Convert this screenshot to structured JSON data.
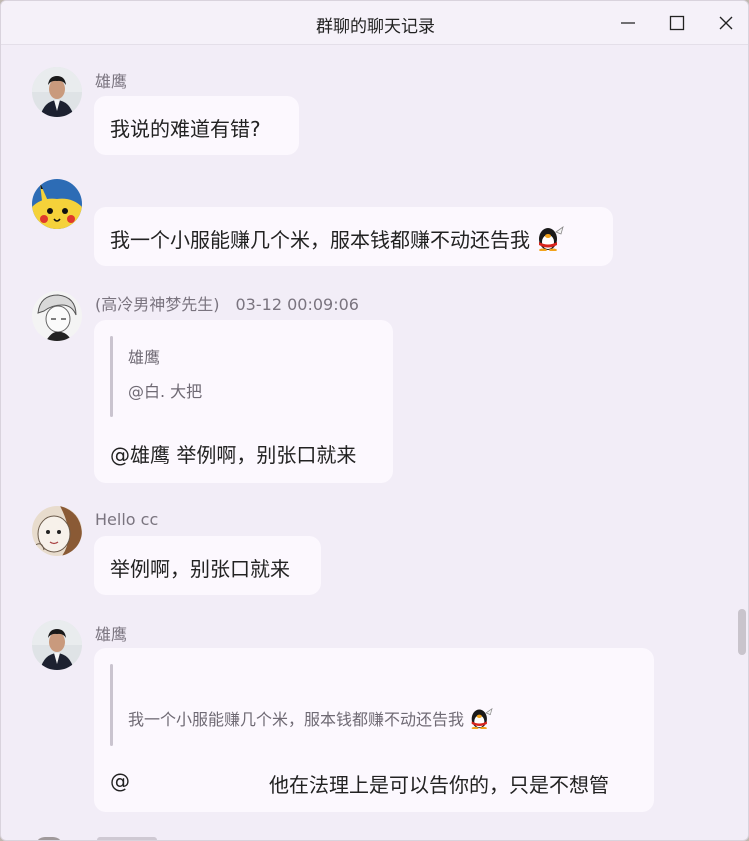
{
  "window": {
    "title": "群聊的聊天记录",
    "controls": [
      "minimize-icon",
      "maximize-icon",
      "close-icon"
    ]
  },
  "messages": [
    {
      "sender": "雄鹰",
      "text": "我说的难道有错?"
    },
    {
      "sender": "",
      "text": "我一个小服能赚几个米，服本钱都赚不动还告我",
      "emoji": "qq-penguin-icon"
    },
    {
      "sender": "(高冷男神梦先生)",
      "time": "03-12 00:09:06",
      "quote_sender": "雄鹰",
      "quote_text": "@白. 大把",
      "text": "@雄鹰 举例啊，别张口就来"
    },
    {
      "sender": "Hello cc",
      "text": "举例啊，别张口就来"
    },
    {
      "sender": "雄鹰",
      "quote_text": "我一个小服能赚几个米，服本钱都赚不动还告我",
      "quote_emoji": "qq-penguin-icon",
      "text_prefix": "@",
      "text": "他在法理上是可以告你的，只是不想管"
    }
  ],
  "colors": {
    "background": "#f2edf7",
    "bubble": "#fcf8fe",
    "sender_text": "#7a747f"
  }
}
